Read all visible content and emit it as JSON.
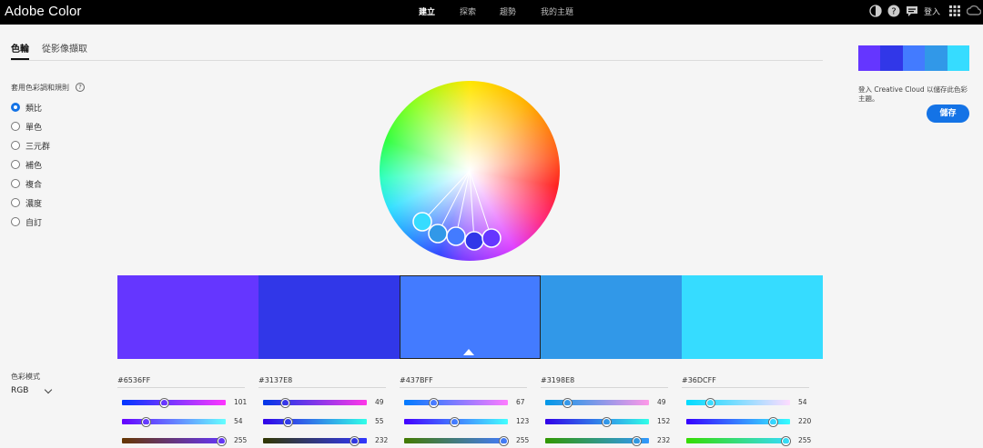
{
  "app": {
    "title": "Adobe Color"
  },
  "nav": [
    {
      "label": "建立",
      "active": true
    },
    {
      "label": "探索",
      "active": false
    },
    {
      "label": "趨勢",
      "active": false
    },
    {
      "label": "我的主題",
      "active": false
    }
  ],
  "header_right": {
    "login": "登入",
    "icons": [
      "theme-contrast-icon",
      "help-icon",
      "feedback-icon",
      "apps-grid-icon",
      "creative-cloud-icon"
    ]
  },
  "tabs": [
    {
      "label": "色輪",
      "active": true
    },
    {
      "label": "從影像擷取",
      "active": false
    }
  ],
  "rules": {
    "title": "套用色彩調和規則",
    "selected": "類比",
    "options": [
      "類比",
      "單色",
      "三元群",
      "補色",
      "複合",
      "濃度",
      "自訂"
    ]
  },
  "color_mode": {
    "label": "色彩模式",
    "value": "RGB"
  },
  "swatches": [
    {
      "hex": "#6536FF",
      "color": "#6536FF",
      "rgb": [
        101,
        54,
        255
      ]
    },
    {
      "hex": "#3137E8",
      "color": "#3137E8",
      "rgb": [
        49,
        55,
        232
      ]
    },
    {
      "hex": "#437BFF",
      "color": "#437BFF",
      "rgb": [
        67,
        123,
        255
      ],
      "selected": true
    },
    {
      "hex": "#3198E8",
      "color": "#3198E8",
      "rgb": [
        49,
        152,
        232
      ]
    },
    {
      "hex": "#36DCFF",
      "color": "#36DCFF",
      "rgb": [
        54,
        220,
        255
      ]
    }
  ],
  "right_panel": {
    "note": "登入 Creative Cloud 以儲存此色彩主題。",
    "save_label": "儲存"
  }
}
